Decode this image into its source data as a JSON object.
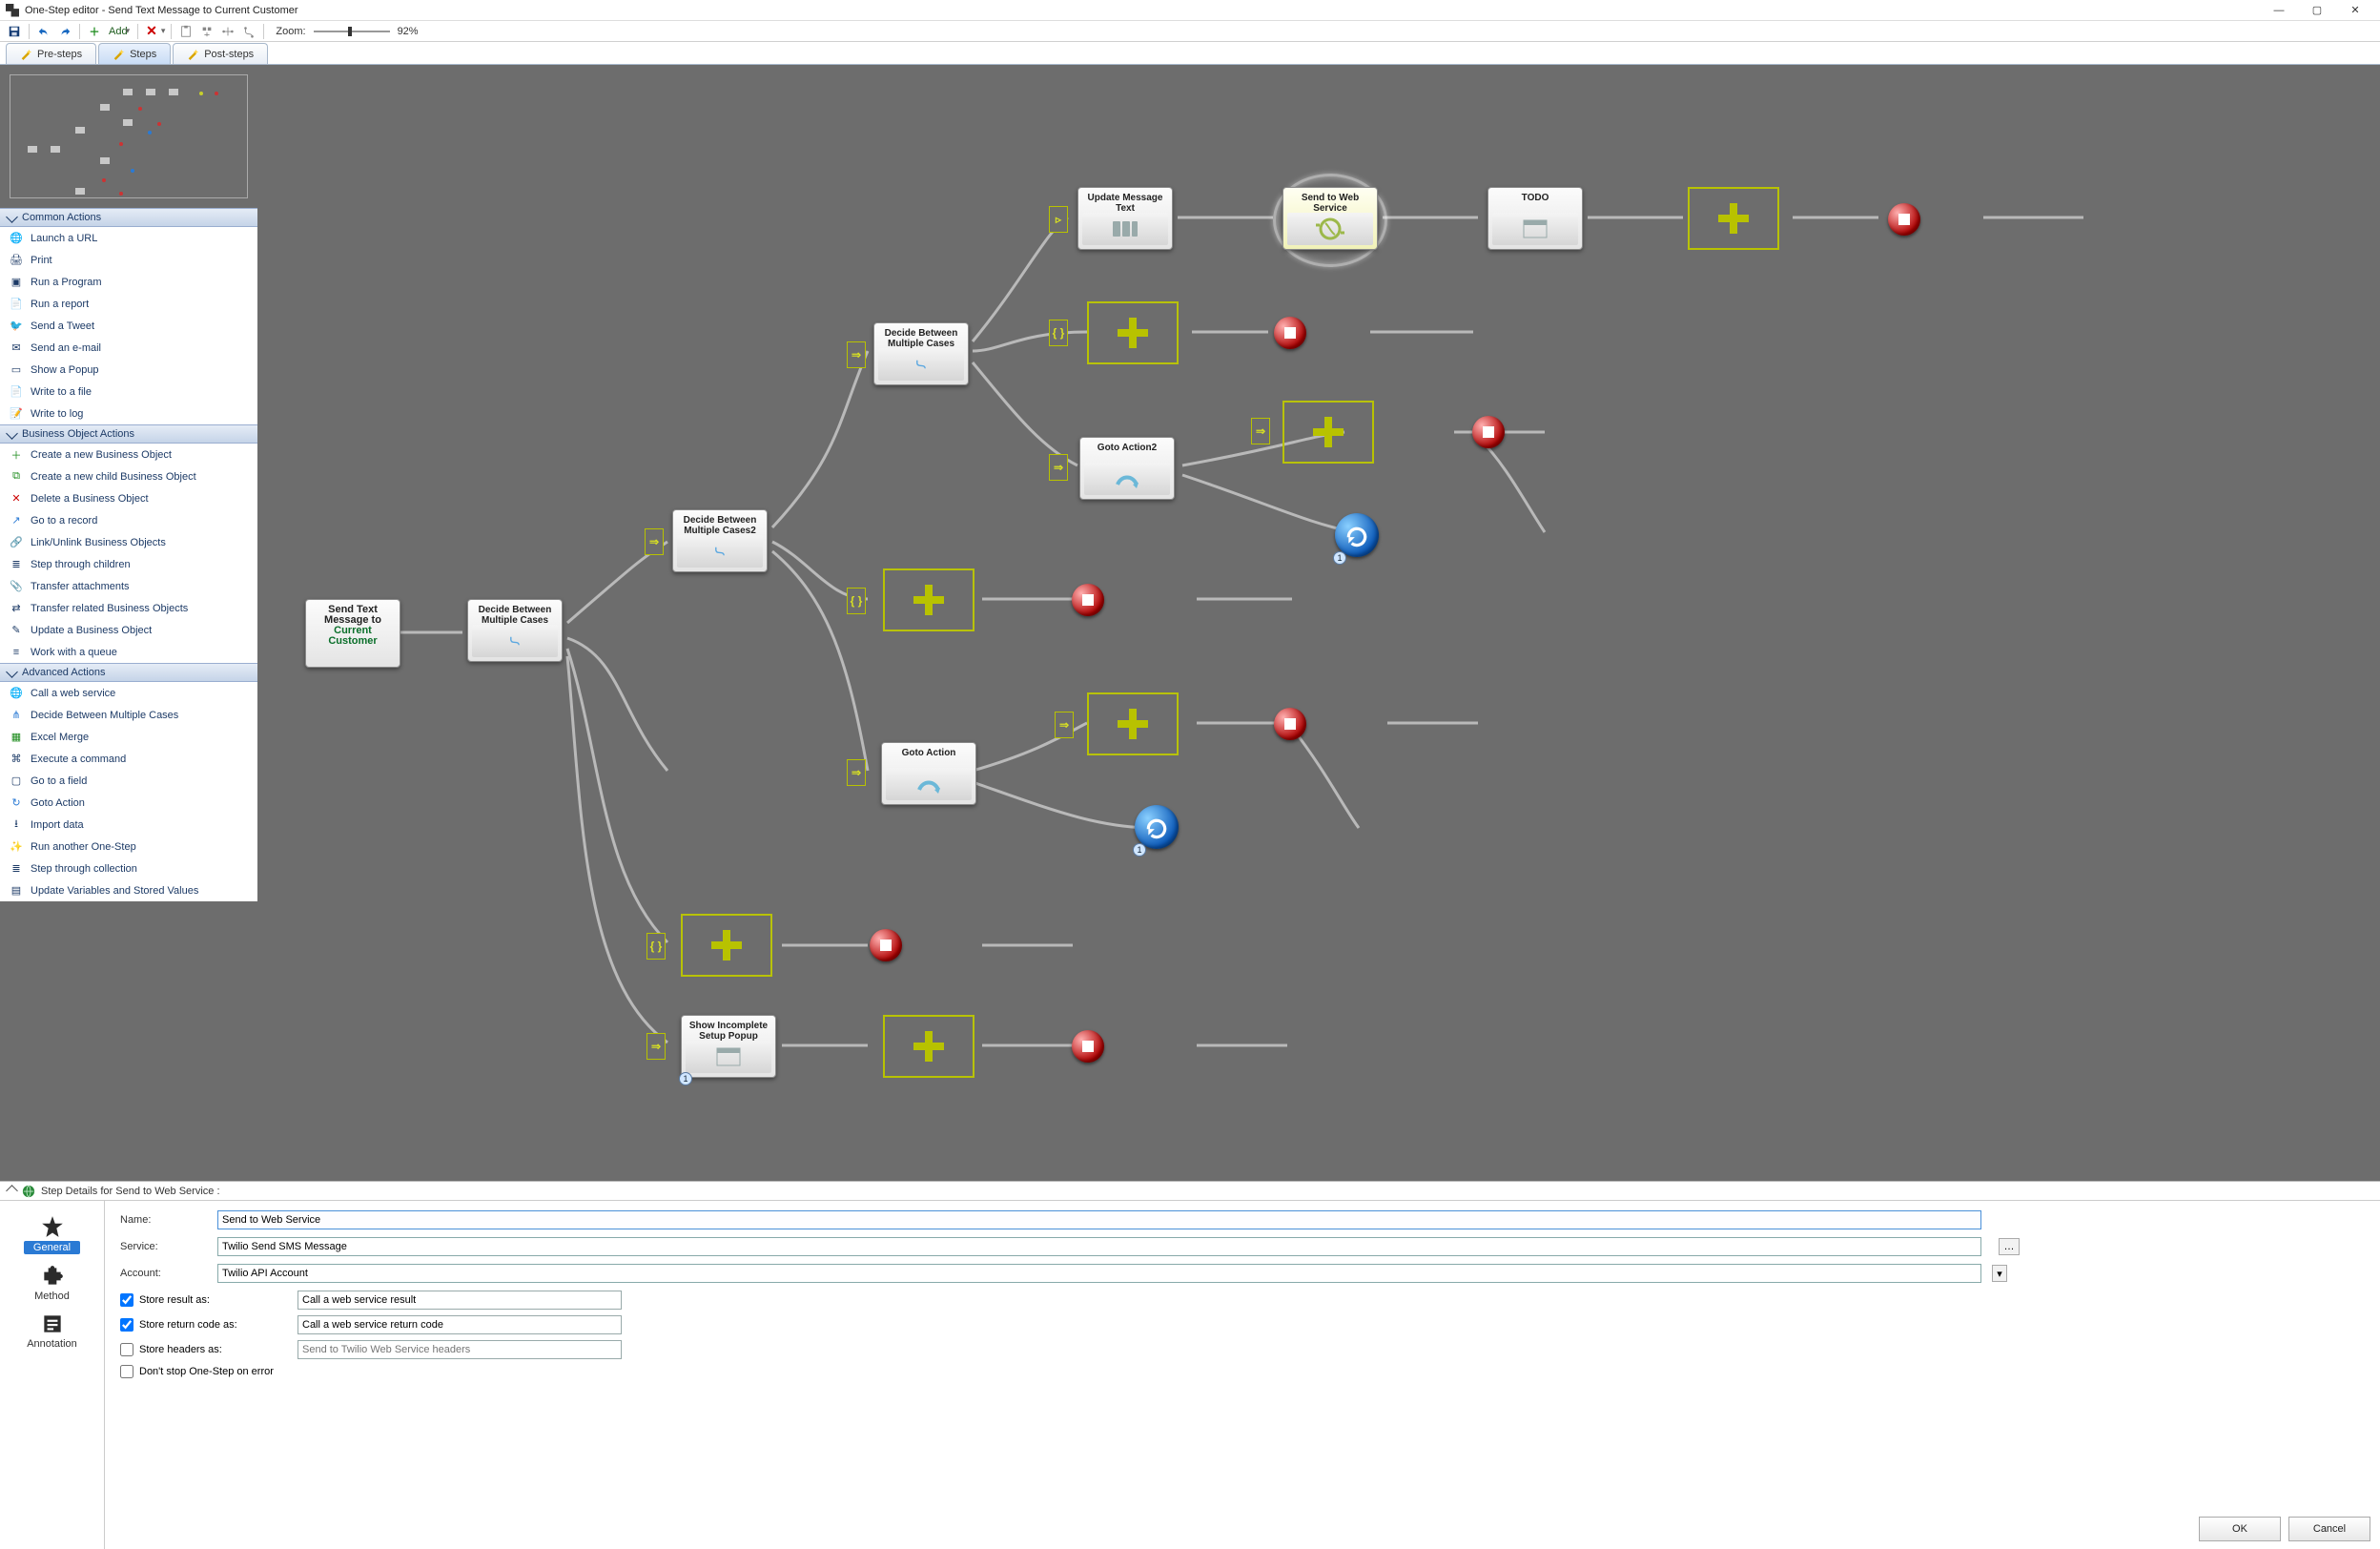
{
  "window": {
    "title": "One-Step editor - Send Text Message to Current Customer"
  },
  "toolbar": {
    "add": "Add",
    "zoom_label": "Zoom:",
    "zoom_value": "92%",
    "zoom_pos_pct": 46
  },
  "tabs": {
    "pre": "Pre-steps",
    "steps": "Steps",
    "post": "Post-steps"
  },
  "sidebar": {
    "sections": {
      "common": "Common Actions",
      "bo": "Business Object Actions",
      "adv": "Advanced Actions"
    },
    "common_items": [
      "Launch a URL",
      "Print",
      "Run a Program",
      "Run a report",
      "Send a Tweet",
      "Send an e-mail",
      "Show a Popup",
      "Write to a file",
      "Write to log"
    ],
    "bo_items": [
      "Create a new Business Object",
      "Create a new child Business Object",
      "Delete a Business Object",
      "Go to a record",
      "Link/Unlink Business Objects",
      "Step through children",
      "Transfer attachments",
      "Transfer related Business Objects",
      "Update a Business Object",
      "Work with a queue"
    ],
    "adv_items": [
      "Call a web service",
      "Decide Between Multiple Cases",
      "Excel Merge",
      "Execute a command",
      "Go to a field",
      "Goto Action",
      "Import data",
      "Run another One-Step",
      "Step through collection",
      "Update Variables and Stored Values"
    ]
  },
  "nodes": {
    "send_text": {
      "l1": "Send Text",
      "l2": "Message to",
      "l3": "Current",
      "l4": "Customer"
    },
    "decide1": "Decide Between\nMultiple Cases",
    "decide2": "Decide Between\nMultiple Cases2",
    "decide3": "Decide Between\nMultiple Cases",
    "update_msg": "Update Message\nText",
    "send_web": "Send to Web\nService",
    "todo": "TODO",
    "goto2": "Goto Action2",
    "goto": "Goto Action",
    "show_popup": "Show Incomplete\nSetup Popup"
  },
  "details": {
    "header": "Step Details for Send to Web Service :",
    "tabs": {
      "general": "General",
      "method": "Method",
      "annotation": "Annotation"
    },
    "form": {
      "name_label": "Name:",
      "name_value": "Send to Web Service",
      "service_label": "Service:",
      "service_value": "Twilio Send SMS Message",
      "account_label": "Account:",
      "account_value": "Twilio API Account",
      "store_result": "Store result as:",
      "store_result_val": "Call a web service result",
      "store_code": "Store return code as:",
      "store_code_val": "Call a web service return code",
      "store_headers": "Store headers as:",
      "store_headers_ph": "Send to Twilio Web Service headers",
      "dont_stop": "Don't stop One-Step on error"
    }
  },
  "buttons": {
    "ok": "OK",
    "cancel": "Cancel"
  },
  "badge_one": "1"
}
